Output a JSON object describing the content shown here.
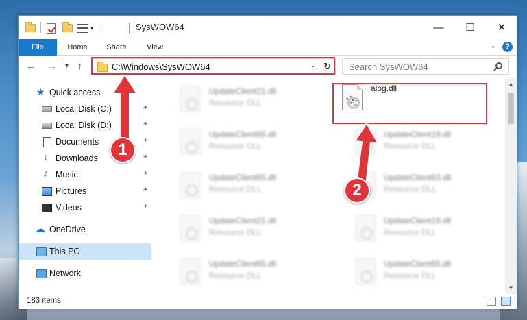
{
  "window": {
    "title": "SysWOW64",
    "controls": {
      "minimize": "—",
      "maximize": "☐",
      "close": "✕"
    }
  },
  "ribbon": {
    "tabs": [
      {
        "label": "File"
      },
      {
        "label": "Home"
      },
      {
        "label": "Share"
      },
      {
        "label": "View"
      }
    ],
    "help": "?"
  },
  "nav": {
    "back": "←",
    "forward": "→",
    "recent": "▾",
    "up": "↑",
    "address": "C:\\Windows\\SysWOW64",
    "search_placeholder": "Search SysWOW64"
  },
  "sidebar": {
    "items": [
      {
        "label": "Quick access",
        "icon": "star-icon"
      },
      {
        "label": "Local Disk (C:)",
        "icon": "drive-icon",
        "pinned": true
      },
      {
        "label": "Local Disk (D:)",
        "icon": "drive-icon",
        "pinned": true
      },
      {
        "label": "Documents",
        "icon": "documents-icon",
        "pinned": true
      },
      {
        "label": "Downloads",
        "icon": "download-icon",
        "pinned": true
      },
      {
        "label": "Music",
        "icon": "music-icon",
        "pinned": true
      },
      {
        "label": "Pictures",
        "icon": "pictures-icon",
        "pinned": true
      },
      {
        "label": "Videos",
        "icon": "videos-icon",
        "pinned": true
      },
      {
        "label": "OneDrive",
        "icon": "cloud-icon"
      },
      {
        "label": "This PC",
        "icon": "computer-icon",
        "selected": true
      },
      {
        "label": "Network",
        "icon": "network-icon"
      }
    ]
  },
  "files": {
    "highlighted": {
      "name": "alog.dll"
    },
    "left_column": [
      {
        "name": "UpdateClient21.dll",
        "type": "Resource DLL"
      },
      {
        "name": "UpdateClient65.dll",
        "type": "Resource DLL"
      },
      {
        "name": "UpdateClient65.dll",
        "type": "Resource DLL"
      },
      {
        "name": "UpdateClient21.dll",
        "type": "Resource DLL"
      },
      {
        "name": "UpdateClient65.dll",
        "type": "Resource DLL"
      }
    ],
    "right_column": [
      {
        "name": "UpdateClient19.dll",
        "type": "Resource DLL"
      },
      {
        "name": "UpdateClient63.dll",
        "type": "Resource DLL"
      },
      {
        "name": "UpdateClient19.dll",
        "type": "Resource DLL"
      },
      {
        "name": "UpdateClient65.dll",
        "type": "Resource DLL"
      }
    ]
  },
  "status": {
    "item_count": "183 items"
  },
  "annotations": {
    "step1": "1",
    "step2": "2",
    "accent": "#e0333a"
  }
}
